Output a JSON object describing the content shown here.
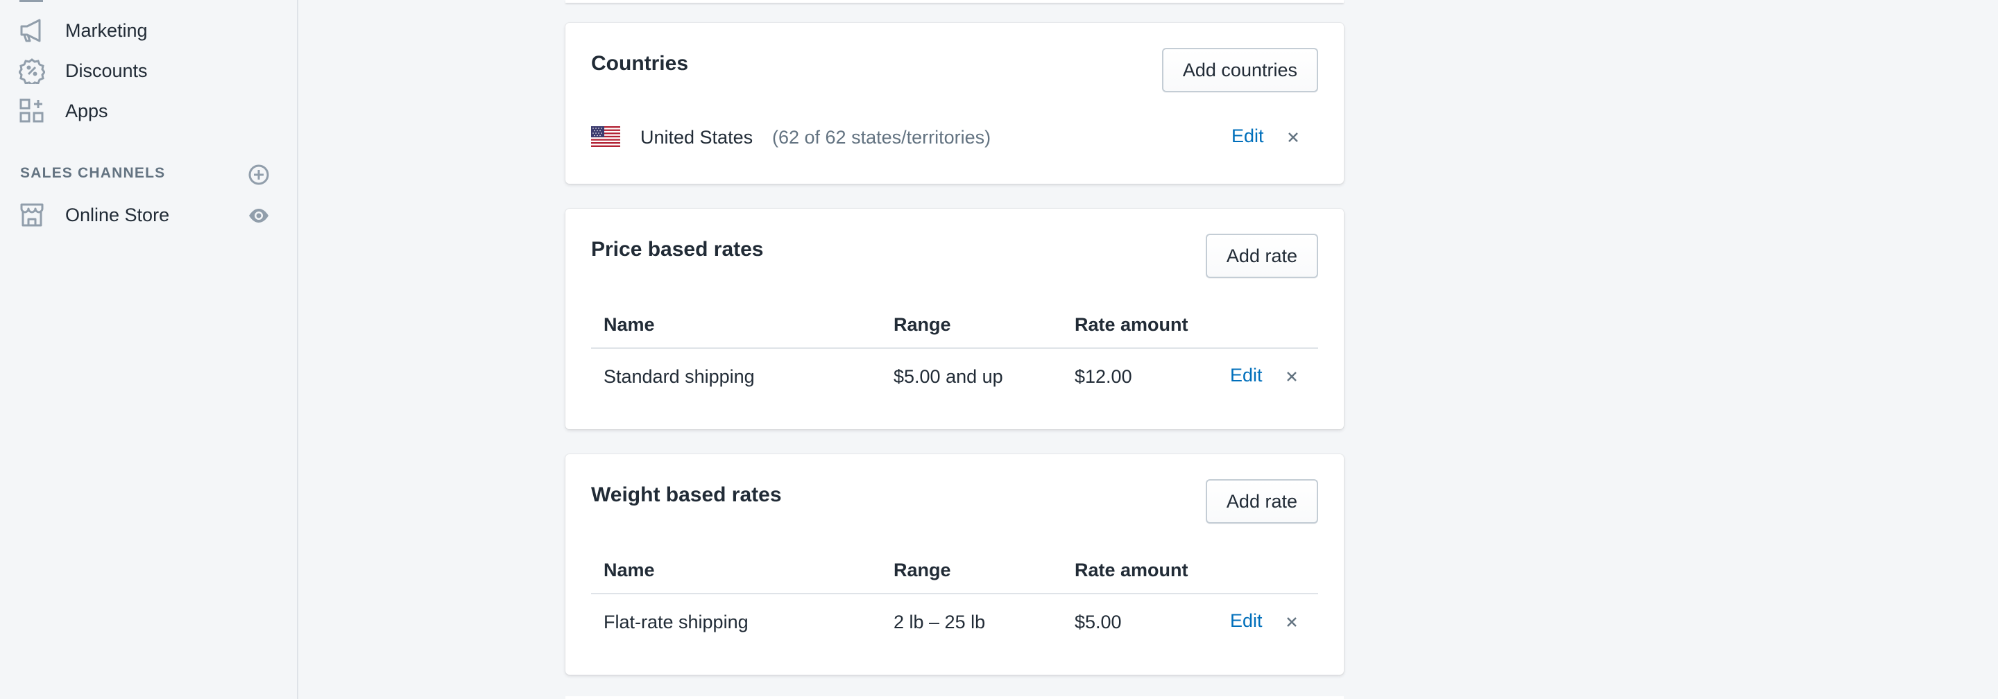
{
  "sidebar": {
    "items": [
      {
        "label": "Marketing",
        "icon": "megaphone-icon"
      },
      {
        "label": "Discounts",
        "icon": "discount-badge-icon"
      },
      {
        "label": "Apps",
        "icon": "apps-grid-icon"
      }
    ],
    "sales_channels": {
      "heading": "SALES CHANNELS",
      "items": [
        {
          "label": "Online Store",
          "icon": "store-icon"
        }
      ]
    }
  },
  "countries_card": {
    "title": "Countries",
    "add_button": "Add countries",
    "rows": [
      {
        "country": "United States",
        "detail": "(62 of 62 states/territories)",
        "edit": "Edit"
      }
    ]
  },
  "price_rates_card": {
    "title": "Price based rates",
    "add_button": "Add rate",
    "columns": [
      "Name",
      "Range",
      "Rate amount"
    ],
    "rows": [
      {
        "name": "Standard shipping",
        "range": "$5.00 and up",
        "amount": "$12.00",
        "edit": "Edit"
      }
    ]
  },
  "weight_rates_card": {
    "title": "Weight based rates",
    "add_button": "Add rate",
    "columns": [
      "Name",
      "Range",
      "Rate amount"
    ],
    "rows": [
      {
        "name": "Flat-rate shipping",
        "range": "2 lb – 25 lb",
        "amount": "$5.00",
        "edit": "Edit"
      }
    ]
  },
  "colors": {
    "link": "#006fbb",
    "icon": "#919eab",
    "text": "#212b36",
    "muted": "#637381",
    "background": "#f4f6f8"
  }
}
